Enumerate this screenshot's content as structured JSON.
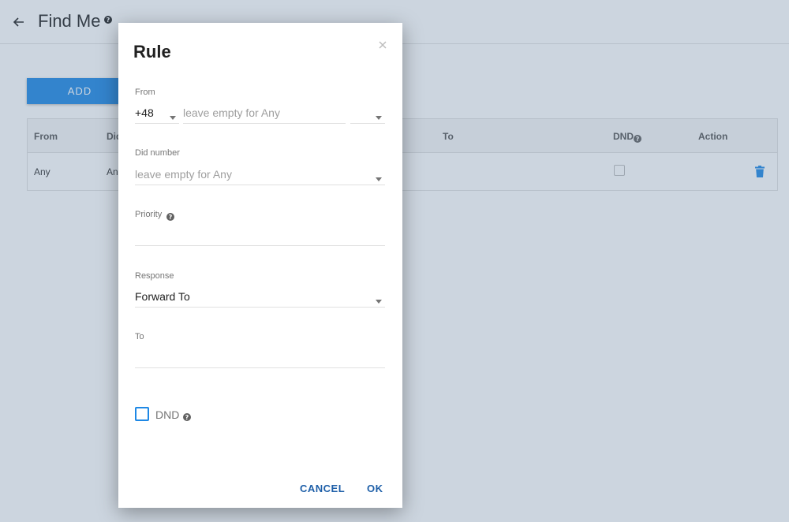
{
  "header": {
    "title": "Find Me"
  },
  "toolbar": {
    "add_label": "ADD"
  },
  "table": {
    "columns": [
      "From",
      "Did",
      "To",
      "DND",
      "Action"
    ],
    "rows": [
      {
        "from": "Any",
        "did": "An"
      }
    ]
  },
  "dialog": {
    "title": "Rule",
    "close": "×",
    "from": {
      "label": "From",
      "prefix": "+48",
      "placeholder": "leave empty for Any"
    },
    "did": {
      "label": "Did number",
      "placeholder": "leave empty for Any"
    },
    "priority": {
      "label": "Priority",
      "value": ""
    },
    "response": {
      "label": "Response",
      "value": "Forward To"
    },
    "to": {
      "label": "To",
      "value": ""
    },
    "dnd": {
      "label": "DND",
      "checked": false
    },
    "buttons": {
      "cancel": "CANCEL",
      "ok": "OK"
    }
  },
  "colors": {
    "accent": "#1e88e5",
    "dialog_button": "#1e5fa8",
    "overlay": "#607d9b"
  }
}
